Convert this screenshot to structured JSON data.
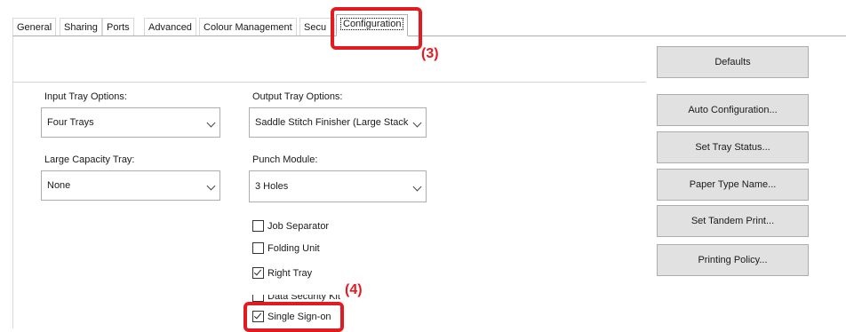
{
  "tabs": [
    {
      "label": "General"
    },
    {
      "label": "Sharing"
    },
    {
      "label": "Ports"
    },
    {
      "label": "Advanced"
    },
    {
      "label": "Colour Management"
    },
    {
      "label": "Secu"
    },
    {
      "label": "Configuration",
      "active": true
    }
  ],
  "callouts": {
    "step3": "(3)",
    "step4": "(4)"
  },
  "left": {
    "input_tray_label": "Input Tray Options:",
    "input_tray_value": "Four Trays",
    "large_capacity_label": "Large Capacity Tray:",
    "large_capacity_value": "None"
  },
  "middle": {
    "output_tray_label": "Output Tray Options:",
    "output_tray_value": "Saddle Stitch Finisher (Large Stack",
    "punch_label": "Punch Module:",
    "punch_value": "3 Holes",
    "options": [
      {
        "label": "Job Separator",
        "checked": false
      },
      {
        "label": "Folding Unit",
        "checked": false
      },
      {
        "label": "Right Tray",
        "checked": true
      },
      {
        "label": "Data Security Kit",
        "checked": false
      },
      {
        "label": "Single Sign-on",
        "checked": true
      }
    ]
  },
  "buttons": {
    "defaults": "Defaults",
    "auto_config": "Auto Configuration...",
    "tray_status": "Set Tray Status...",
    "paper_type": "Paper Type Name...",
    "tandem": "Set Tandem Print...",
    "policy": "Printing Policy..."
  },
  "colors": {
    "highlight": "#e21b23",
    "button_face": "#e1e1e1"
  }
}
